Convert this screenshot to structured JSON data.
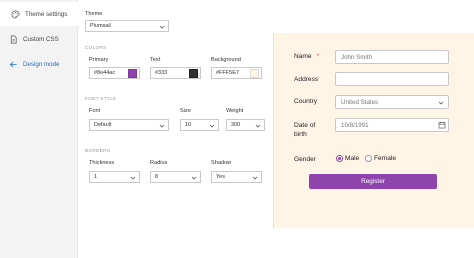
{
  "sidebar": {
    "items": [
      {
        "label": "Theme settings",
        "icon": "palette-icon",
        "active": true
      },
      {
        "label": "Custom CSS",
        "icon": "document-icon",
        "active": false
      },
      {
        "label": "Design mode",
        "icon": "arrow-left-icon",
        "active": false
      }
    ]
  },
  "settings": {
    "theme_label": "Theme",
    "theme_value": "Plumsail",
    "colors_section": "COLORS",
    "primary_label": "Primary",
    "primary_value": "#8e44ac",
    "text_label": "Text",
    "text_value": "#333",
    "background_label": "Background",
    "background_value": "#FFF5E7",
    "font_section": "FONT STYLE",
    "font_label": "Font",
    "font_value": "Default",
    "size_label": "Size",
    "size_value": "10",
    "weight_label": "Weight",
    "weight_value": "300",
    "borders_section": "BORDERS",
    "thickness_label": "Thickness",
    "thickness_value": "1",
    "radius_label": "Radius",
    "radius_value": "8",
    "shadow_label": "Shadow",
    "shadow_value": "Yes"
  },
  "colors": {
    "primary": "#8e44ac",
    "text": "#333333",
    "background": "#FFF5E7"
  },
  "form": {
    "name_label": "Name",
    "required_mark": "*",
    "name_placeholder": "John Smith",
    "address_label": "Address",
    "address_value": "",
    "country_label": "Country",
    "country_value": "United States",
    "dob_label_line1": "Date of",
    "dob_label_line2": "birth",
    "dob_value": "10/8/1991",
    "gender_label": "Gender",
    "gender_male": "Male",
    "gender_female": "Female",
    "gender_selected": "Male",
    "register_label": "Register"
  }
}
